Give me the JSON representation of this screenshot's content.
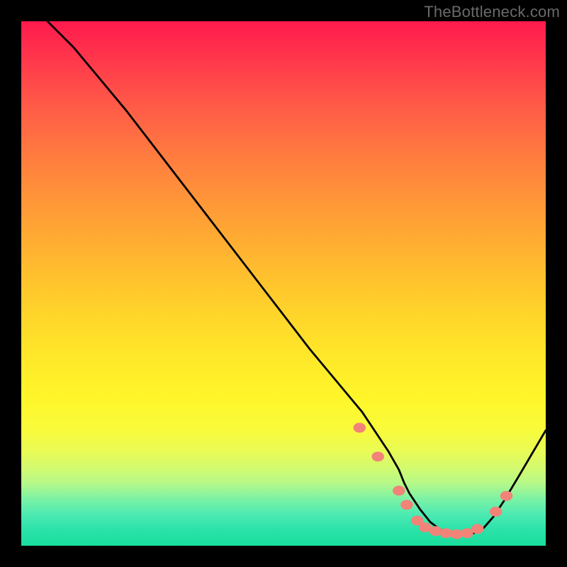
{
  "watermark": "TheBottleneck.com",
  "chart_data": {
    "type": "line",
    "title": "",
    "xlabel": "",
    "ylabel": "",
    "xlim": [
      0,
      100
    ],
    "ylim": [
      0,
      100
    ],
    "series": [
      {
        "name": "curve",
        "stroke": "#000000",
        "x": [
          0,
          2,
          5,
          10,
          15,
          20,
          25,
          30,
          35,
          40,
          45,
          50,
          55,
          60,
          65,
          68,
          70,
          72,
          73,
          74,
          76,
          78,
          80,
          82,
          84,
          85,
          86,
          88,
          90,
          92,
          95,
          100
        ],
        "values": [
          105,
          103,
          100,
          95,
          89,
          83,
          76.5,
          70,
          63.5,
          57,
          50.5,
          44,
          37.5,
          31.5,
          25.5,
          21,
          18,
          14.5,
          12,
          10,
          7,
          4.5,
          3,
          2.3,
          2.2,
          2.2,
          2.3,
          3.2,
          5.5,
          8.5,
          13.5,
          22
        ]
      }
    ],
    "markers": {
      "name": "dots",
      "color": "#f28378",
      "r": 7,
      "points": [
        {
          "x": 64.5,
          "y": 22.5
        },
        {
          "x": 68.0,
          "y": 17.0
        },
        {
          "x": 72.0,
          "y": 10.5
        },
        {
          "x": 73.5,
          "y": 7.8
        },
        {
          "x": 75.5,
          "y": 4.8
        },
        {
          "x": 77.0,
          "y": 3.5
        },
        {
          "x": 79.0,
          "y": 2.8
        },
        {
          "x": 81.0,
          "y": 2.4
        },
        {
          "x": 83.0,
          "y": 2.2
        },
        {
          "x": 85.0,
          "y": 2.4
        },
        {
          "x": 87.0,
          "y": 3.2
        },
        {
          "x": 90.5,
          "y": 6.5
        },
        {
          "x": 92.5,
          "y": 9.5
        }
      ]
    }
  }
}
